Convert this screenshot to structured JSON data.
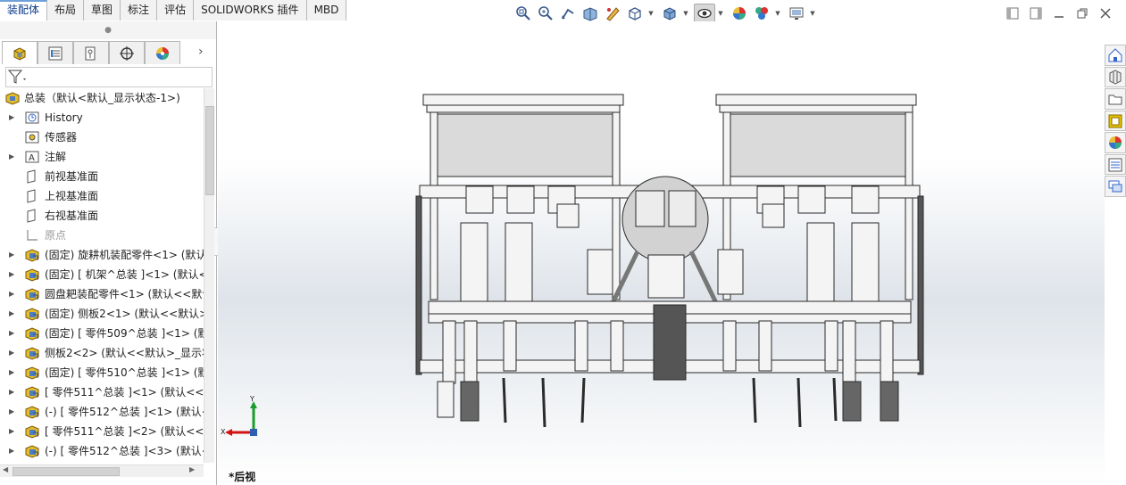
{
  "command_tabs": [
    "装配体",
    "布局",
    "草图",
    "标注",
    "评估",
    "SOLIDWORKS 插件",
    "MBD"
  ],
  "active_tab_index": 0,
  "hud_icons": [
    "zoom-to-fit-icon",
    "zoom-to-area-icon",
    "previous-view-icon",
    "section-view-icon",
    "dynamic-annotation-icon",
    "view-orientation-icon",
    "display-style-icon",
    "hide-show-items-icon",
    "edit-appearance-icon",
    "apply-scene-icon",
    "view-settings-icon"
  ],
  "feature_manager": {
    "root": "总装（默认<默认_显示状态-1>)",
    "items": [
      {
        "label": "History",
        "icon": "history-icon",
        "expand": true
      },
      {
        "label": "传感器",
        "icon": "sensor-icon",
        "expand": false
      },
      {
        "label": "注解",
        "icon": "annotation-icon",
        "expand": true
      },
      {
        "label": "前视基准面",
        "icon": "plane-icon",
        "expand": false
      },
      {
        "label": "上视基准面",
        "icon": "plane-icon",
        "expand": false
      },
      {
        "label": "右视基准面",
        "icon": "plane-icon",
        "expand": false
      },
      {
        "label": "原点",
        "icon": "origin-icon",
        "expand": false,
        "dim": true
      },
      {
        "label": "(固定) 旋耕机装配零件<1> (默认",
        "icon": "subassembly-icon",
        "expand": true
      },
      {
        "label": "(固定) [ 机架^总装 ]<1> (默认<",
        "icon": "subassembly-icon",
        "expand": true
      },
      {
        "label": "圆盘耙装配零件<1> (默认<<默认",
        "icon": "subassembly-icon",
        "expand": true
      },
      {
        "label": "(固定) 侧板2<1> (默认<<默认>",
        "icon": "subassembly-icon",
        "expand": true
      },
      {
        "label": "(固定) [ 零件509^总装 ]<1> (默",
        "icon": "subassembly-icon",
        "expand": true
      },
      {
        "label": "侧板2<2> (默认<<默认>_显示状",
        "icon": "subassembly-icon",
        "expand": true
      },
      {
        "label": "(固定) [ 零件510^总装 ]<1> (默",
        "icon": "subassembly-icon",
        "expand": true
      },
      {
        "label": "[ 零件511^总装 ]<1> (默认<<默",
        "icon": "subassembly-icon",
        "expand": true
      },
      {
        "label": "(-) [ 零件512^总装 ]<1> (默认<",
        "icon": "subassembly-icon",
        "expand": true
      },
      {
        "label": "[ 零件511^总装 ]<2> (默认<<默",
        "icon": "subassembly-icon",
        "expand": true
      },
      {
        "label": "(-) [ 零件512^总装 ]<3> (默认<",
        "icon": "subassembly-icon",
        "expand": true
      }
    ]
  },
  "viewport": {
    "view_name": "*后视",
    "triad": {
      "x": "X",
      "y": "Y"
    }
  },
  "taskpane_icons": [
    "solidworks-resources-icon",
    "design-library-icon",
    "file-explorer-icon",
    "view-palette-icon",
    "appearances-icon",
    "custom-properties-icon",
    "forum-icon"
  ],
  "colors": {
    "accent": "#1f5fb6",
    "yellow": "#e8c400",
    "triad_x": "#d31212",
    "triad_y": "#1a9c2c"
  }
}
